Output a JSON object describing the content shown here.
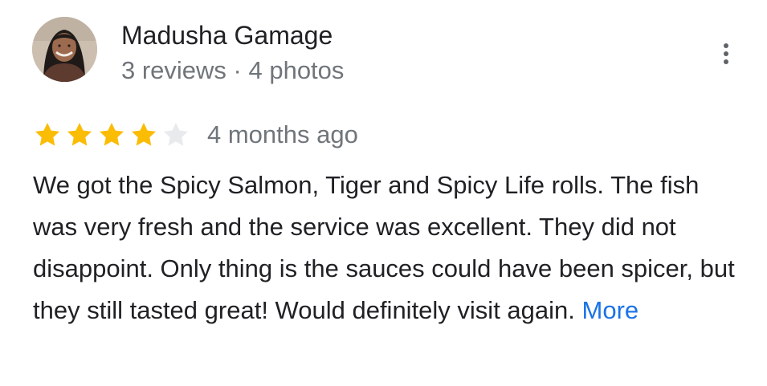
{
  "review": {
    "author_name": "Madusha Gamage",
    "author_meta": "3 reviews · 4 photos",
    "rating": 4,
    "rating_max": 5,
    "date": "4 months ago",
    "text": "We got the Spicy Salmon, Tiger and Spicy Life rolls. The fish was very fresh and the service was excellent. They did not disappoint. Only thing is the sauces could have been spicer, but they still tasted great! Would definitely visit again.",
    "more_label": "More"
  },
  "icons": {
    "more_options": "more-vert-icon",
    "star_filled": "star-filled-icon",
    "star_empty": "star-empty-icon"
  },
  "colors": {
    "star_filled": "#fbbc04",
    "star_empty": "#e8eaed",
    "link": "#1a73e8",
    "secondary_text": "#70757a",
    "primary_text": "#202124"
  }
}
